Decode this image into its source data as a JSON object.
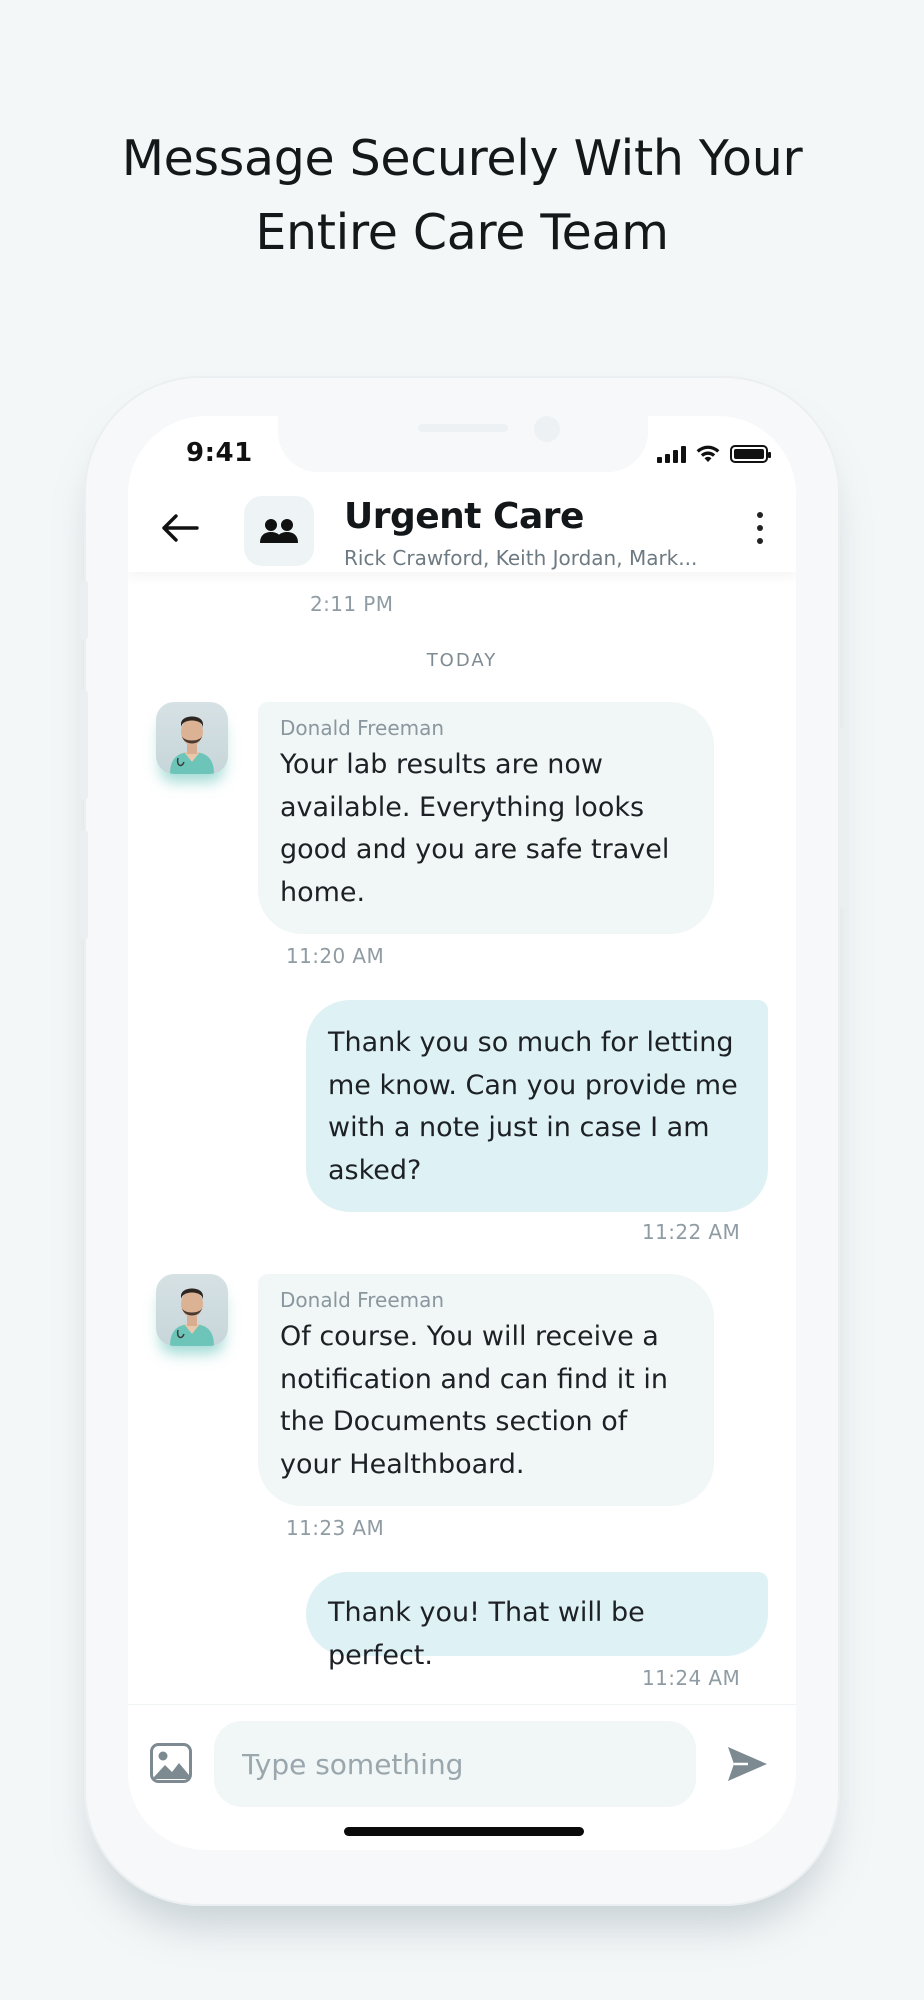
{
  "headline": {
    "line1": "Message Securely With Your",
    "line2": "Entire Care Team"
  },
  "status_bar": {
    "time": "9:41"
  },
  "header": {
    "title": "Urgent Care",
    "members": "Rick Crawford, Keith Jordan, Mark..."
  },
  "messages": {
    "earlier_timestamp": "2:11 PM",
    "day_separator": "TODAY",
    "items": [
      {
        "direction": "incoming",
        "sender": "Donald Freeman",
        "text": "Your lab results are now available. Everything looks good and you are safe travel home.",
        "time": "11:20 AM"
      },
      {
        "direction": "outgoing",
        "text": "Thank you so much for letting me know. Can you provide me with a note just in case I am asked?",
        "time": "11:22 AM"
      },
      {
        "direction": "incoming",
        "sender": "Donald Freeman",
        "text": "Of course. You will receive a notification and can find it in the Documents section of your Healthboard.",
        "time": "11:23 AM"
      },
      {
        "direction": "outgoing",
        "text": "Thank you! That will be perfect.",
        "time": "11:24 AM"
      }
    ]
  },
  "composer": {
    "placeholder": "Type something",
    "value": ""
  },
  "icons": {
    "back": "arrow-left-icon",
    "group": "people-icon",
    "more": "more-vertical-icon",
    "image": "image-icon",
    "send": "send-icon"
  },
  "colors": {
    "page_bg": "#f4f7f8",
    "incoming_bubble": "#f1f6f7",
    "outgoing_bubble": "#def1f4",
    "timestamp": "#8f9ca3"
  }
}
